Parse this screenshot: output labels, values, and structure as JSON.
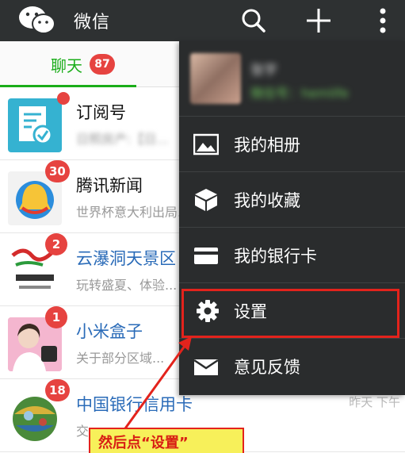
{
  "topbar": {
    "title": "微信",
    "icons": [
      "wechat-logo-icon",
      "search-icon",
      "plus-icon",
      "more-vertical-icon"
    ]
  },
  "tabs": {
    "chat_label": "聊天",
    "chat_badge": "87"
  },
  "chats": [
    {
      "name": "订阅号",
      "preview": "日照房产:【日...",
      "badge": "",
      "time": ""
    },
    {
      "name": "腾讯新闻",
      "preview": "世界杯意大利出局...",
      "badge": "30",
      "time": ""
    },
    {
      "name": "云瀑洞天景区",
      "preview": "玩转盛夏、体验...",
      "badge": "2",
      "time": ""
    },
    {
      "name": "小米盒子",
      "preview": "关于部分区域...",
      "badge": "1",
      "time": ""
    },
    {
      "name": "中国银行信用卡",
      "preview": "交...",
      "badge": "18",
      "time": "昨天 下午"
    }
  ],
  "menu": {
    "user_name": "张宇",
    "user_id": "微信号：hemlife",
    "items": [
      {
        "label": "我的相册",
        "icon": "photo-icon"
      },
      {
        "label": "我的收藏",
        "icon": "cube-icon"
      },
      {
        "label": "我的银行卡",
        "icon": "card-icon"
      },
      {
        "label": "设置",
        "icon": "gear-icon"
      },
      {
        "label": "意见反馈",
        "icon": "mail-icon"
      }
    ]
  },
  "annotation": {
    "callout_text": "然后点“设置”"
  },
  "colors": {
    "topbar": "#2e3132",
    "accent_green": "#1aad19",
    "badge_red": "#e64340",
    "menu_bg": "#2a2c2d",
    "highlight": "#e3231c",
    "callout_bg": "#f7f05a"
  }
}
